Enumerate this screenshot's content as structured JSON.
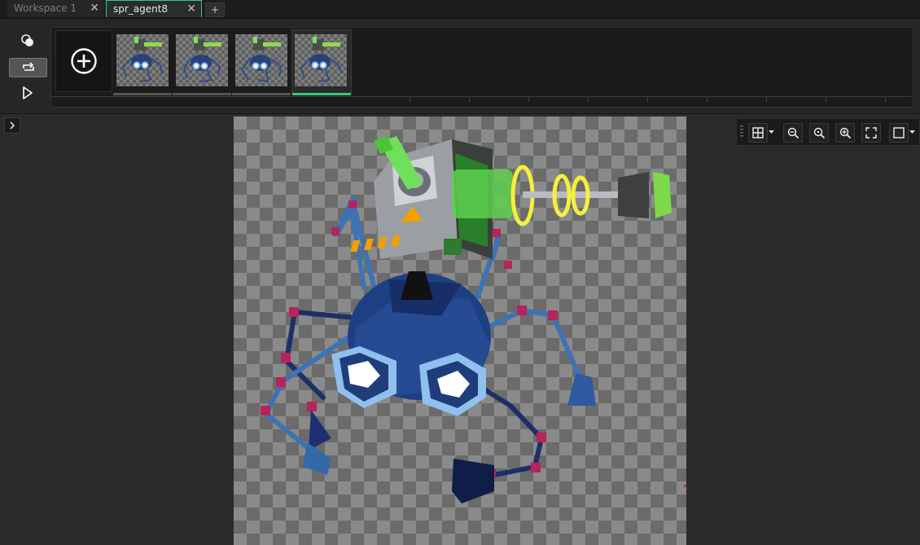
{
  "tabs": [
    {
      "label": "Workspace 1",
      "close": "✕"
    },
    {
      "label": "spr_agent8",
      "close": "✕"
    }
  ],
  "tab_add": "+",
  "frames": {
    "count": 4,
    "selected_index": 3
  },
  "icons": {
    "onion_skin": "onion-skin-icon",
    "loop": "loop-icon",
    "play": "play-icon",
    "add_frame": "add-frame-icon",
    "expand_panel": "chevron-right-icon",
    "grid": "grid-icon",
    "zoom_out": "zoom-out-icon",
    "zoom_reset": "zoom-reset-icon",
    "zoom_in": "zoom-in-icon",
    "fit": "fullscreen-icon",
    "background": "background-square-icon"
  },
  "colors": {
    "accent": "#2bd07c"
  }
}
